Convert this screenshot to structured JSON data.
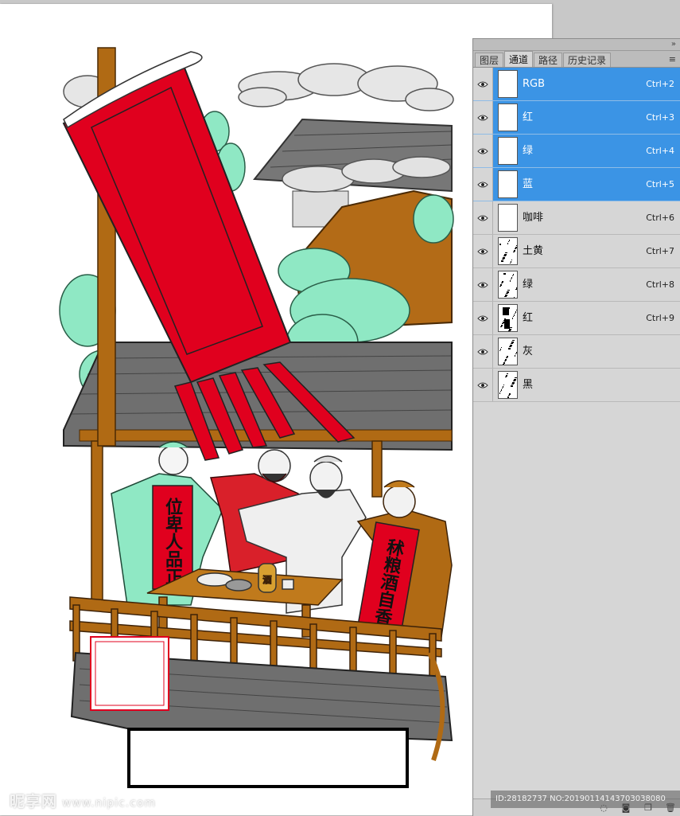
{
  "panel": {
    "tabs": [
      "图层",
      "通道",
      "路径",
      "历史记录"
    ],
    "active_tab": "通道",
    "channels": [
      {
        "name": "RGB",
        "shortcut": "Ctrl+2",
        "selected": true
      },
      {
        "name": "红",
        "shortcut": "Ctrl+3",
        "selected": true
      },
      {
        "name": "绿",
        "shortcut": "Ctrl+4",
        "selected": true
      },
      {
        "name": "蓝",
        "shortcut": "Ctrl+5",
        "selected": true
      },
      {
        "name": "咖啡",
        "shortcut": "Ctrl+6",
        "selected": false
      },
      {
        "name": "土黄",
        "shortcut": "Ctrl+7",
        "selected": false
      },
      {
        "name": "绿",
        "shortcut": "Ctrl+8",
        "selected": false
      },
      {
        "name": "红",
        "shortcut": "Ctrl+9",
        "selected": false
      },
      {
        "name": "灰",
        "shortcut": "",
        "selected": false
      },
      {
        "name": "黑",
        "shortcut": "",
        "selected": false
      }
    ]
  },
  "artwork": {
    "scroll_left": "位卑人品正",
    "scroll_right": "秫粮酒自香",
    "jar_label": "酒"
  },
  "watermark": {
    "brand": "昵享网",
    "url": "www.nipic.com"
  },
  "id_text": "ID:28182737 NO:20190114143703038080",
  "colors": {
    "selection": "#3b94e5",
    "flag_red": "#e0001e",
    "foliage": "#8fe8c4",
    "wood": "#b06a14"
  }
}
